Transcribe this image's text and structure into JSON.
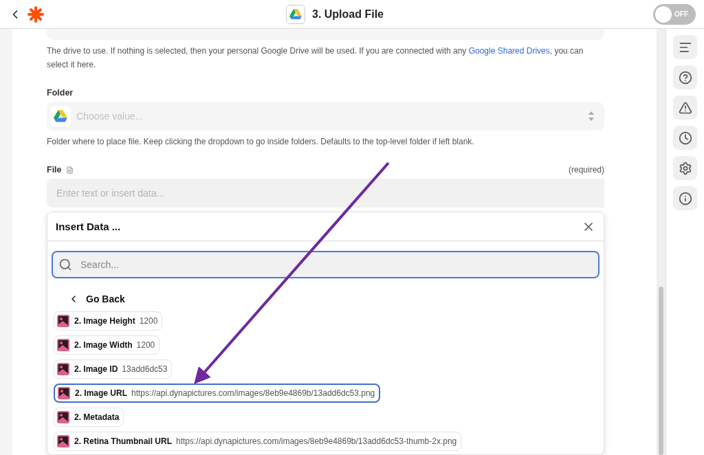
{
  "header": {
    "title": "3. Upload File",
    "toggle": {
      "label": "OFF",
      "on": false
    }
  },
  "drive_field": {
    "help": "The drive to use. If nothing is selected, then your personal Google Drive will be used. If you are connected with any ",
    "help_link": "Google Shared Drives",
    "help_end": ", you can select it here."
  },
  "folder_field": {
    "label": "Folder",
    "placeholder": "Choose value...",
    "help": "Folder where to place file. Keep clicking the dropdown to go inside folders. Defaults to the top-level folder if left blank."
  },
  "file_field": {
    "label": "File",
    "required": "(required)",
    "placeholder": "Enter text or insert data..."
  },
  "insert_panel": {
    "title": "Insert Data ...",
    "search_placeholder": "Search...",
    "back": "Go Back",
    "items": [
      {
        "name": "2. Image Height",
        "value": "1200",
        "selected": false
      },
      {
        "name": "2. Image Width",
        "value": "1200",
        "selected": false
      },
      {
        "name": "2. Image ID",
        "value": "13add6dc53",
        "selected": false
      },
      {
        "name": "2. Image URL",
        "value": "https://api.dynapictures.com/images/8eb9e4869b/13add6dc53.png",
        "selected": true
      },
      {
        "name": "2. Metadata",
        "selected": false
      },
      {
        "name": "2. Retina Thumbnail URL",
        "value": "https://api.dynapictures.com/images/8eb9e4869b/13add6dc53-thumb-2x.png",
        "selected": false
      }
    ]
  },
  "sidebar": {
    "items": [
      {
        "kind": "lines"
      },
      {
        "kind": "help"
      },
      {
        "kind": "warning"
      },
      {
        "kind": "clock"
      },
      {
        "kind": "settings"
      },
      {
        "kind": "info"
      }
    ]
  }
}
